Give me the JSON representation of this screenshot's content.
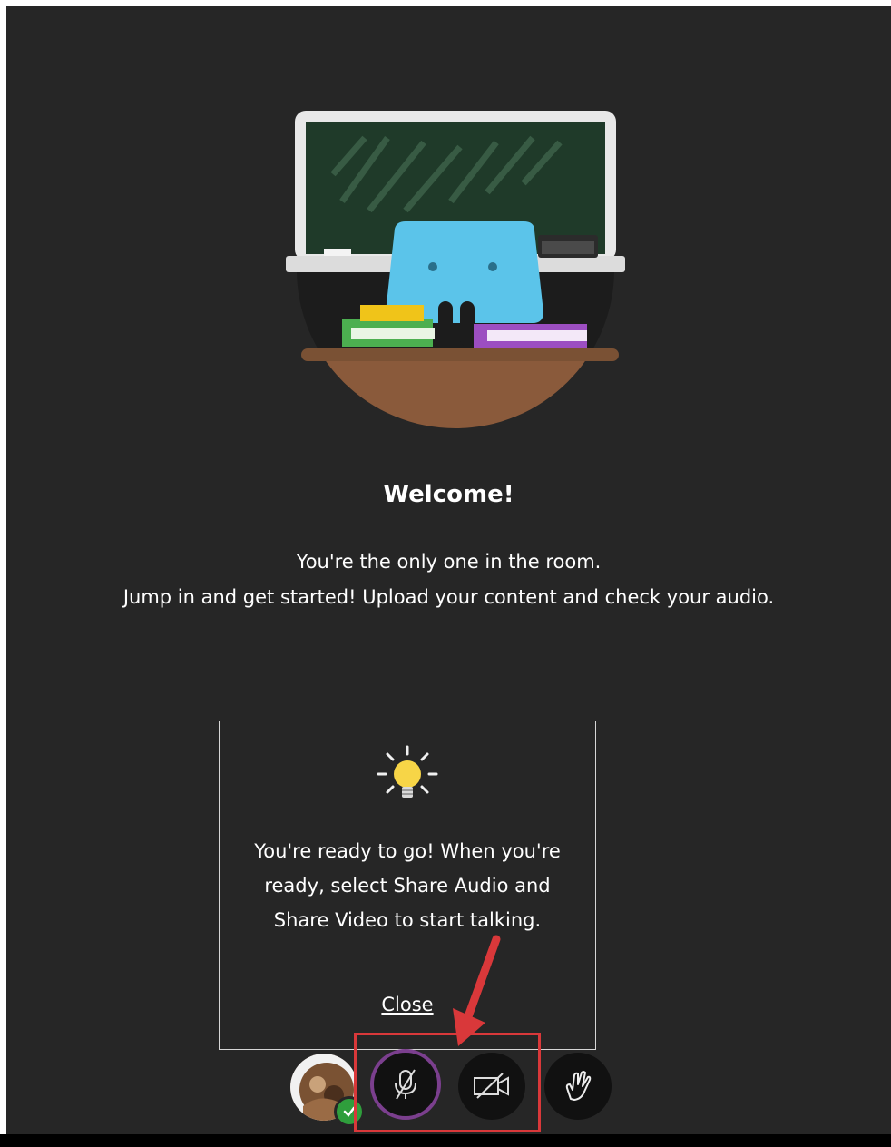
{
  "welcome": {
    "title": "Welcome!",
    "line1": "You're the only one in the room.",
    "line2": "Jump in and get started! Upload your content and check your audio."
  },
  "tip": {
    "message": "You're ready to go! When you're ready, select Share Audio and Share Video to start talking.",
    "close_label": "Close"
  },
  "controls": {
    "avatar_icon": "user-avatar",
    "status_icon": "check-icon",
    "audio_icon": "microphone-muted-icon",
    "video_icon": "camera-off-icon",
    "hand_icon": "raise-hand-icon"
  },
  "colors": {
    "background": "#262626",
    "accent_purple": "#7b3f8e",
    "annotation_red": "#d9383a",
    "status_green": "#2f9e3c",
    "bulb_yellow": "#f7d547"
  }
}
